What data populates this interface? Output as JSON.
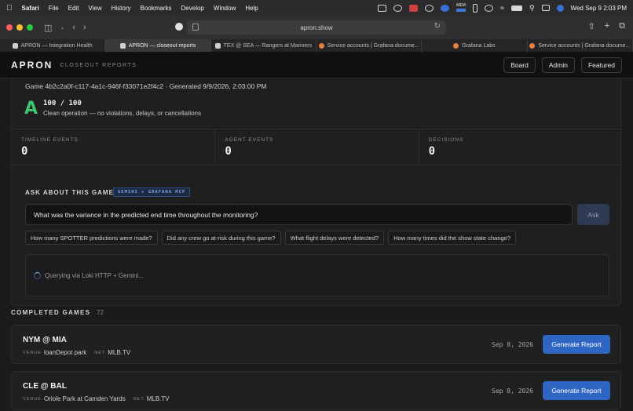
{
  "menubar": {
    "app": "Safari",
    "items": [
      "File",
      "Edit",
      "View",
      "History",
      "Bookmarks",
      "Develop",
      "Window",
      "Help"
    ],
    "mem_label": "MEM",
    "clock": "Wed Sep 9  2:03 PM"
  },
  "browser": {
    "url": "apron.show",
    "tabs": [
      {
        "label": "APRON — Integration Health",
        "active": false,
        "color": "#cfcfcf"
      },
      {
        "label": "APRON — closeout reports",
        "active": true,
        "color": "#cfcfcf"
      },
      {
        "label": "TEX @ SEA — Rangers at Mariners",
        "active": false,
        "color": "#cfcfcf"
      },
      {
        "label": "Service accounts | Grafana docume...",
        "active": false,
        "color": "#e8823a"
      },
      {
        "label": "Grafana Labs",
        "active": false,
        "color": "#e8823a"
      },
      {
        "label": "Service accounts | Grafana docume...",
        "active": false,
        "color": "#e8823a"
      }
    ]
  },
  "header": {
    "brand": "APRON",
    "subtitle": "CLOSEOUT REPORTS",
    "nav": [
      "Board",
      "Admin",
      "Featured"
    ]
  },
  "report": {
    "meta": "Game 4b2c2a0f-c117-4a1c-946f-f33071e2f4c2 · Generated 9/9/2026, 2:03:00 PM",
    "grade": "A",
    "score": "100 / 100",
    "description": "Clean operation — no violations, delays, or cancellations",
    "stats": [
      {
        "label": "TIMELINE EVENTS",
        "value": "0"
      },
      {
        "label": "AGENT EVENTS",
        "value": "0"
      },
      {
        "label": "DECISIONS",
        "value": "0"
      }
    ]
  },
  "ask": {
    "title": "ASK ABOUT THIS GAME",
    "badge": "GEMINI + GRAFANA MCP",
    "question": "What was the variance in the predicted end time throughout the monitoring?",
    "button": "Ask",
    "suggestions": [
      "How many SPOTTER predictions were made?",
      "Did any crew go at-risk during this game?",
      "What flight delays were detected?",
      "How many times did the show state change?"
    ],
    "status": "Querying via Loki HTTP + Gemini..."
  },
  "completed": {
    "title": "COMPLETED GAMES",
    "count": "72",
    "venue_label": "VENUE",
    "net_label": "NET",
    "button": "Generate Report",
    "games": [
      {
        "title": "NYM @ MIA",
        "venue": "loanDepot park",
        "net": "MLB.TV",
        "date": "Sep 8, 2026"
      },
      {
        "title": "CLE @ BAL",
        "venue": "Oriole Park at Camden Yards",
        "net": "MLB.TV",
        "date": "Sep 8, 2026"
      }
    ]
  },
  "colors": {
    "accent": "#2f66c4",
    "grade": "#3ec46d",
    "background": "#1b1b1b"
  }
}
